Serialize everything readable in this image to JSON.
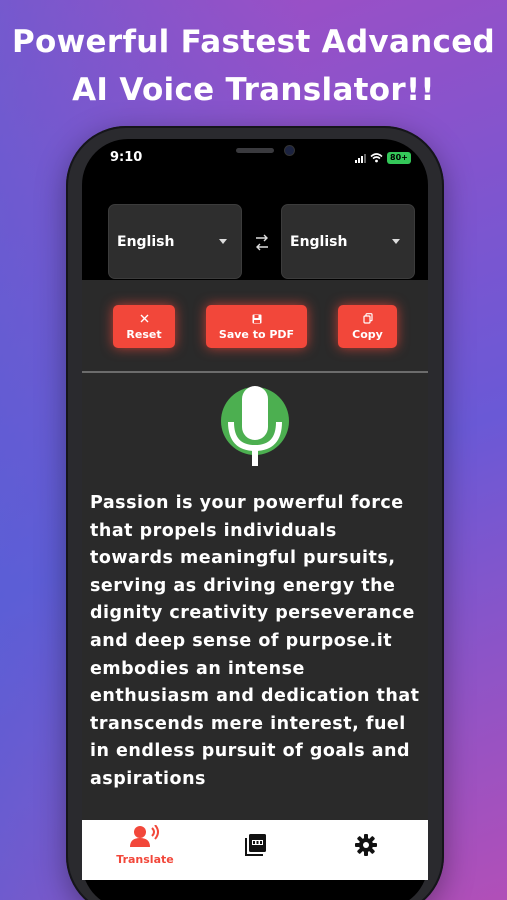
{
  "headline": {
    "line1": "Powerful Fastest Advanced",
    "line2": "AI Voice Translator!!"
  },
  "status_bar": {
    "time": "9:10",
    "battery": "80+"
  },
  "languages": {
    "source": "English",
    "target": "English"
  },
  "actions": {
    "reset_label": "Reset",
    "save_pdf_label": "Save to PDF",
    "copy_label": "Copy"
  },
  "content": {
    "text": "Passion is your powerful force that propels individuals towards meaningful pursuits, serving as driving energy the dignity creativity perseverance and deep sense of purpose.it embodies an intense enthusiasm and dedication that transcends mere interest, fuel in endless pursuit of goals and aspirations"
  },
  "tabbar": {
    "translate_label": "Translate"
  },
  "colors": {
    "accent": "#f2473a",
    "mic": "#4caf50",
    "panel": "#2a2a2a",
    "battery": "#34c759"
  },
  "icons": {
    "reset": "close-icon",
    "save_pdf": "floppy-disk-icon",
    "copy": "copy-icon",
    "swap": "swap-arrows-icon",
    "mic": "microphone-icon",
    "translate_tab": "voice-translate-icon",
    "pdf_tab": "pdf-file-icon",
    "settings_tab": "gear-icon"
  }
}
